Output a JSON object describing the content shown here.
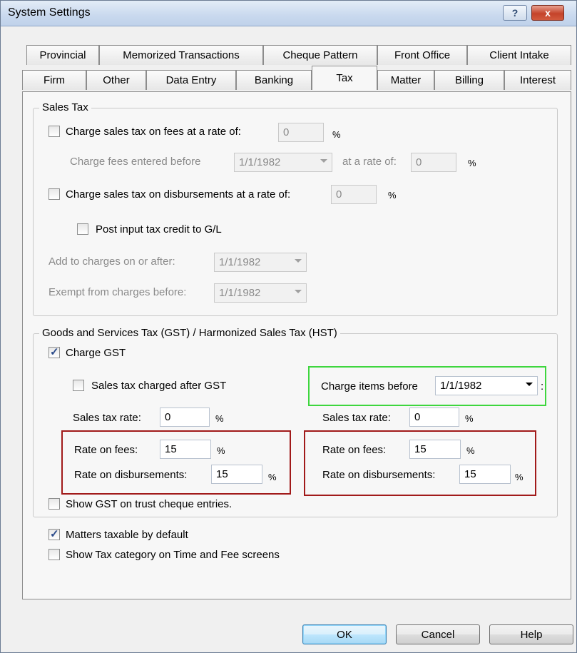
{
  "window": {
    "title": "System Settings",
    "help_glyph": "?",
    "close_glyph": "x"
  },
  "tabs": {
    "row1": [
      "Provincial",
      "Memorized Transactions",
      "Cheque Pattern",
      "Front Office",
      "Client Intake"
    ],
    "row2": [
      "Firm",
      "Other",
      "Data Entry",
      "Banking",
      "Tax",
      "Matter",
      "Billing",
      "Interest"
    ],
    "active": "Tax"
  },
  "sales_tax": {
    "group_title": "Sales Tax",
    "charge_fees_label": "Charge sales tax on fees at a rate of:",
    "charge_fees_value": "0",
    "charge_fees_checked": false,
    "fees_entered_before_label": "Charge fees entered before",
    "fees_entered_before_date": "1/1/1982",
    "at_rate_label": "at a rate of:",
    "at_rate_value": "0",
    "charge_disb_label": "Charge sales tax on disbursements at a rate of:",
    "charge_disb_value": "0",
    "charge_disb_checked": false,
    "post_input_label": "Post input tax credit to G/L",
    "post_input_checked": false,
    "add_to_charges_label": "Add to charges on or after:",
    "add_to_charges_date": "1/1/1982",
    "exempt_label": "Exempt from charges before:",
    "exempt_date": "1/1/1982"
  },
  "gst": {
    "group_title": "Goods and Services Tax (GST) / Harmonized Sales Tax (HST)",
    "charge_gst_label": "Charge GST",
    "charge_gst_checked": true,
    "after_gst_label": "Sales tax charged after GST",
    "after_gst_checked": false,
    "charge_items_before_label": "Charge items before",
    "charge_items_before_date": "1/1/1982",
    "charge_items_suffix": ":",
    "left": {
      "sales_tax_rate_label": "Sales tax rate:",
      "sales_tax_rate_value": "0",
      "rate_fees_label": "Rate on fees:",
      "rate_fees_value": "15",
      "rate_disb_label": "Rate on disbursements:",
      "rate_disb_value": "15"
    },
    "right": {
      "sales_tax_rate_label": "Sales tax rate:",
      "sales_tax_rate_value": "0",
      "rate_fees_label": "Rate on fees:",
      "rate_fees_value": "15",
      "rate_disb_label": "Rate on disbursements:",
      "rate_disb_value": "15"
    },
    "show_gst_trust_label": "Show GST on trust cheque entries.",
    "show_gst_trust_checked": false
  },
  "options": {
    "matters_taxable_label": "Matters taxable by default",
    "matters_taxable_checked": true,
    "show_tax_category_label": "Show Tax category on Time and Fee screens",
    "show_tax_category_checked": false
  },
  "percent_sign": "%",
  "buttons": {
    "ok": "OK",
    "cancel": "Cancel",
    "help": "Help"
  },
  "colors": {
    "highlight_green": "#3ed63e",
    "highlight_red": "#a11a1a",
    "titlebar": "#c9d9ee",
    "close_red": "#c4432a"
  }
}
